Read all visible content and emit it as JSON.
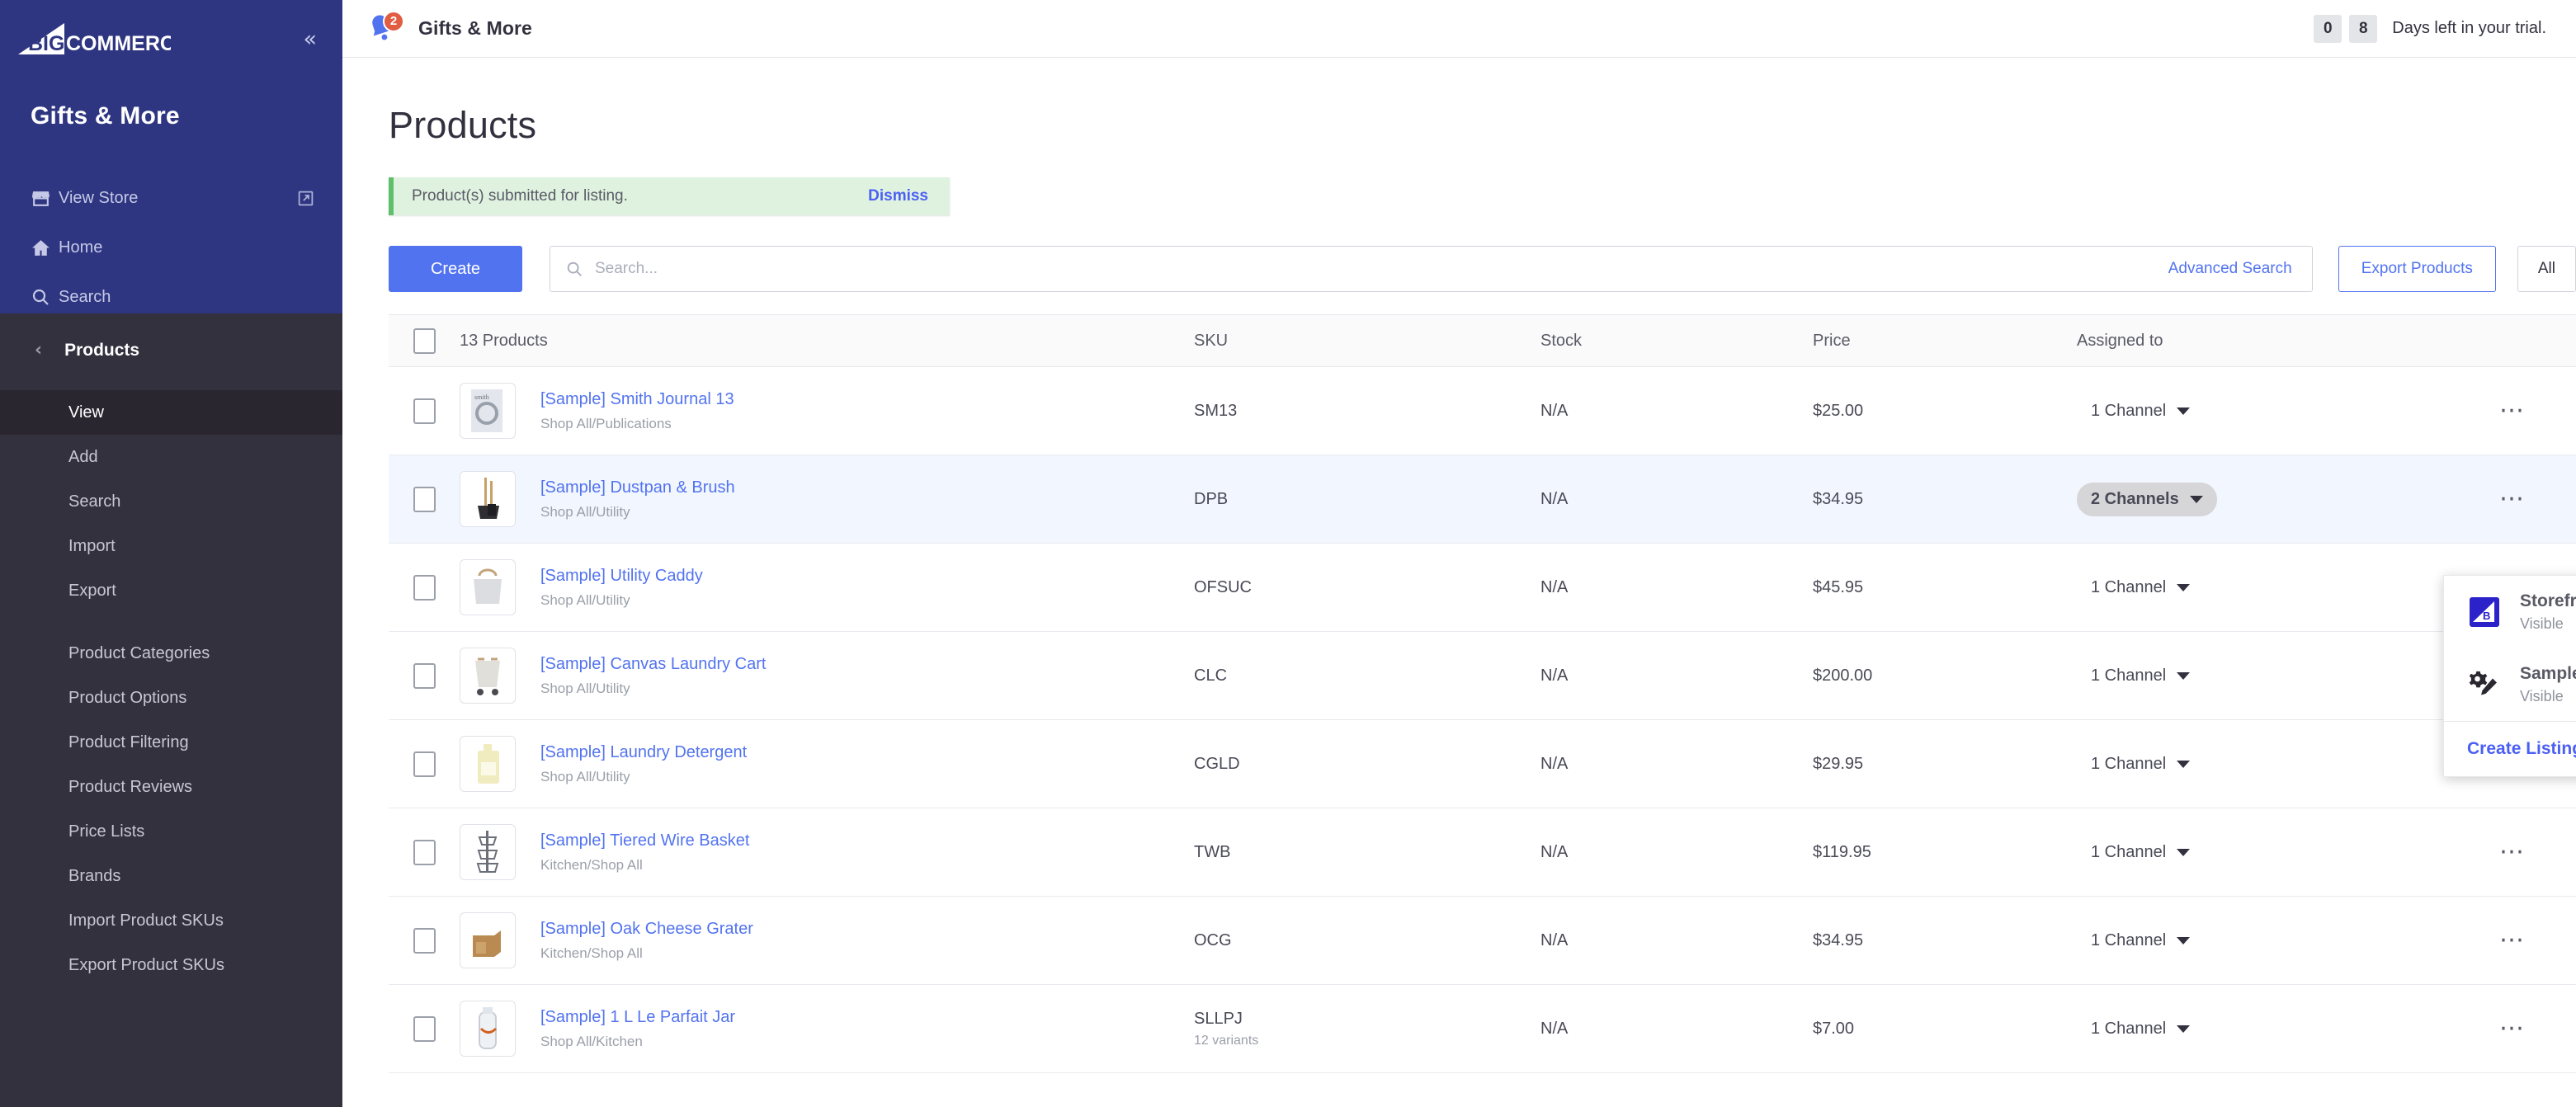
{
  "sidebar": {
    "logo_text": "BIGCOMMERCE",
    "collapse_icon": "chevron-double-left-icon",
    "store_name": "Gifts & More",
    "links": [
      {
        "label": "View Store",
        "icon": "storefront-icon",
        "external": true
      },
      {
        "label": "Home",
        "icon": "home-icon",
        "external": false
      },
      {
        "label": "Search",
        "icon": "search-icon",
        "external": false
      }
    ],
    "section": {
      "label": "Products",
      "back_icon": "chevron-left-icon"
    },
    "sub_items_group1": [
      {
        "label": "View",
        "active": true
      },
      {
        "label": "Add",
        "active": false
      },
      {
        "label": "Search",
        "active": false
      },
      {
        "label": "Import",
        "active": false
      },
      {
        "label": "Export",
        "active": false
      }
    ],
    "sub_items_group2": [
      {
        "label": "Product Categories",
        "active": false
      },
      {
        "label": "Product Options",
        "active": false
      },
      {
        "label": "Product Filtering",
        "active": false
      },
      {
        "label": "Product Reviews",
        "active": false
      },
      {
        "label": "Price Lists",
        "active": false
      },
      {
        "label": "Brands",
        "active": false
      },
      {
        "label": "Import Product SKUs",
        "active": false
      },
      {
        "label": "Export Product SKUs",
        "active": false
      }
    ]
  },
  "topbar": {
    "bell_icon": "notification-bell-icon",
    "notification_count": "2",
    "title": "Gifts & More",
    "trial_digits": [
      "0",
      "8"
    ],
    "trial_text": "Days left in your trial."
  },
  "page": {
    "title": "Products",
    "alert": {
      "message": "Product(s) submitted for listing.",
      "dismiss_label": "Dismiss"
    },
    "toolbar": {
      "create_label": "Create",
      "search_placeholder": "Search...",
      "search_value": "",
      "search_icon": "search-icon",
      "advanced_search_label": "Advanced Search",
      "export_label": "Export Products",
      "filter_label": "All"
    }
  },
  "table": {
    "headers": {
      "count": "13 Products",
      "sku": "SKU",
      "stock": "Stock",
      "price": "Price",
      "assigned": "Assigned to"
    },
    "rows": [
      {
        "name": "[Sample] Smith Journal 13",
        "category": "Shop All/Publications",
        "sku": "SM13",
        "variants": "",
        "stock": "N/A",
        "price": "$25.00",
        "channel": "1 Channel",
        "open": false,
        "highlight": false
      },
      {
        "name": "[Sample] Dustpan & Brush",
        "category": "Shop All/Utility",
        "sku": "DPB",
        "variants": "",
        "stock": "N/A",
        "price": "$34.95",
        "channel": "2 Channels",
        "open": true,
        "highlight": true
      },
      {
        "name": "[Sample] Utility Caddy",
        "category": "Shop All/Utility",
        "sku": "OFSUC",
        "variants": "",
        "stock": "N/A",
        "price": "$45.95",
        "channel": "1 Channel",
        "open": false,
        "highlight": false
      },
      {
        "name": "[Sample] Canvas Laundry Cart",
        "category": "Shop All/Utility",
        "sku": "CLC",
        "variants": "",
        "stock": "N/A",
        "price": "$200.00",
        "channel": "1 Channel",
        "open": false,
        "highlight": false
      },
      {
        "name": "[Sample] Laundry Detergent",
        "category": "Shop All/Utility",
        "sku": "CGLD",
        "variants": "",
        "stock": "N/A",
        "price": "$29.95",
        "channel": "1 Channel",
        "open": false,
        "highlight": false
      },
      {
        "name": "[Sample] Tiered Wire Basket",
        "category": "Kitchen/Shop All",
        "sku": "TWB",
        "variants": "",
        "stock": "N/A",
        "price": "$119.95",
        "channel": "1 Channel",
        "open": false,
        "highlight": false
      },
      {
        "name": "[Sample] Oak Cheese Grater",
        "category": "Kitchen/Shop All",
        "sku": "OCG",
        "variants": "",
        "stock": "N/A",
        "price": "$34.95",
        "channel": "1 Channel",
        "open": false,
        "highlight": false
      },
      {
        "name": "[Sample] 1 L Le Parfait Jar",
        "category": "Shop All/Kitchen",
        "sku": "SLLPJ",
        "variants": "12 variants",
        "stock": "N/A",
        "price": "$7.00",
        "channel": "1 Channel",
        "open": false,
        "highlight": false
      }
    ]
  },
  "dropdown": {
    "items": [
      {
        "title": "Storefront",
        "status": "Visible",
        "icon": "bigcommerce-storefront-icon"
      },
      {
        "title": "Sample POS",
        "status": "Visible",
        "icon": "pos-gear-pencil-icon"
      }
    ],
    "action_label": "Create Listing"
  },
  "colors": {
    "sidebar_top": "#2f3681",
    "sidebar_bottom": "#34313f",
    "accent_blue": "#5273f0",
    "link_blue": "#4b5ff5",
    "alert_green": "#5fbf6a",
    "badge_orange": "#e05c42"
  }
}
